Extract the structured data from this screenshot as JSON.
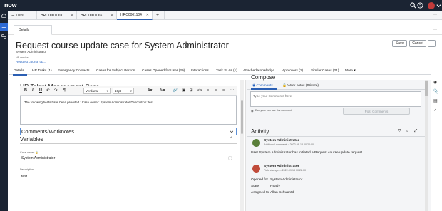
{
  "app": {
    "logo": "now"
  },
  "topbar": {
    "icons": [
      "search-icon",
      "help-icon",
      "bell-icon",
      "user-avatar"
    ]
  },
  "rail": {
    "icons": [
      "home-icon",
      "list-icon",
      "workspace-icon"
    ]
  },
  "tabs": [
    {
      "label": "Lists",
      "icon": "list-icon"
    },
    {
      "label": "HRC0001069"
    },
    {
      "label": "HRC0001065"
    },
    {
      "label": "HRC0001104",
      "active": true
    }
  ],
  "subtab": {
    "label": "Details"
  },
  "record": {
    "title": "Request course update case for System Administrator",
    "subtitle": "System Administrator",
    "hr_service_label": "HR service",
    "hr_service_link": "Request course up...",
    "buttons": {
      "save": "Save",
      "cancel": "Cancel"
    }
  },
  "related_tabs": [
    "Details",
    "HR Tasks (1)",
    "Emergency Contacts",
    "Cases for Subject Person",
    "Cases Opened for User (29)",
    "Interactions",
    "Task SLAs (1)",
    "Attached Knowledge",
    "Approvers (1)",
    "Similar Cases (21)",
    "More"
  ],
  "left": {
    "section_title": "HR Talent Management Case",
    "editor": {
      "font": "Verdana",
      "size": "10pt",
      "text": "The following fields have been provided : Case owner: System Administrator Description: test"
    },
    "comments_bar": "Comments/Worknotes",
    "variables_title": "Variables",
    "case_owner_label": "Case owner",
    "case_owner_value": "System Administrator",
    "description_label": "Description",
    "description_value": "test"
  },
  "compose": {
    "title": "Compose",
    "tab_comments": "Comments",
    "tab_worknotes": "Work notes (Private)",
    "placeholder": "Type your Comments here",
    "see_note": "Everyone can see this comment",
    "post_button": "Post Comments"
  },
  "activity": {
    "title": "Activity",
    "entries": [
      {
        "name": "System Administrator",
        "sub": "Additional comments • 2022-09-13 00:22:00",
        "text": "User System Administrator has initiated a Request course update request"
      },
      {
        "name": "System Administrator",
        "sub": "Field changes • 2022-09-13 00:22:00",
        "fields": [
          {
            "label": "Opened for",
            "value": "System Administrator"
          },
          {
            "label": "State",
            "value": "Ready"
          },
          {
            "label": "Assigned to",
            "value": "Allan Schwantd"
          }
        ]
      }
    ]
  },
  "colors": {
    "topbar": "#1b2433",
    "accent": "#2b5fb3",
    "link": "#1f5fbf"
  }
}
